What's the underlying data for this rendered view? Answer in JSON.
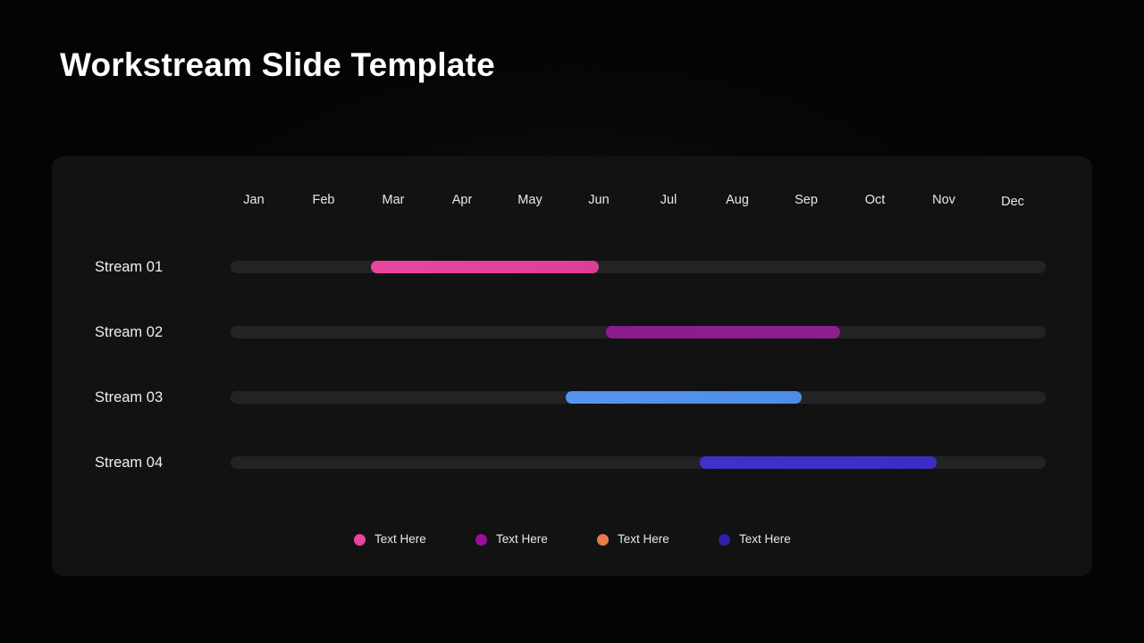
{
  "slide": {
    "title": "Workstream Slide Template",
    "background_color": "#040404",
    "card_color": "#121213"
  },
  "chart_data": {
    "type": "bar",
    "title": "Workstream Slide Template",
    "orientation": "horizontal",
    "xlabel": "",
    "ylabel": "",
    "grid": false,
    "legend_position": "bottom",
    "track_color": "#232325",
    "axis": {
      "categories": [
        "Jan",
        "Feb",
        "Mar",
        "Apr",
        "May",
        "Jun",
        "Jul",
        "Aug",
        "Sep",
        "Oct",
        "Nov",
        "Dec"
      ],
      "tick_x": [
        284,
        362,
        440,
        517,
        593,
        670,
        748,
        825,
        902,
        979,
        1056,
        1133
      ],
      "tick_y": [
        224,
        224,
        224,
        224,
        224,
        224,
        224,
        224,
        224,
        224,
        224,
        226
      ]
    },
    "categories": [
      "Stream 01",
      "Stream 02",
      "Stream 03",
      "Stream 04"
    ],
    "series": [
      {
        "name": "Stream 01",
        "start_month": "Mar",
        "end_month": "Jun",
        "start_x": 415,
        "end_x": 670,
        "row_y": 299,
        "color": "#e8479f",
        "color_end": "#e03e96"
      },
      {
        "name": "Stream 02",
        "start_month": "Jun",
        "end_month": "Sep",
        "start_x": 678,
        "end_x": 940,
        "row_y": 372,
        "color": "#8d1b8d",
        "color_end": "#8e1f90"
      },
      {
        "name": "Stream 03",
        "start_month": "May",
        "end_month": "Aug",
        "start_x": 633,
        "end_x": 897,
        "row_y": 445,
        "color": "#5496ee",
        "color_end": "#4b8ee8"
      },
      {
        "name": "Stream 04",
        "start_month": "Aug",
        "end_month": "Nov",
        "start_x": 783,
        "end_x": 1048,
        "row_y": 518,
        "color": "#3f32cb",
        "color_end": "#3a2ec2"
      }
    ],
    "legend": [
      {
        "label": "Text Here",
        "color": "#e8449c",
        "x": 396
      },
      {
        "label": "Text Here",
        "color": "#9b0f9b",
        "x": 532
      },
      {
        "label": "Text Here",
        "color": "#e87b4a",
        "x": 668
      },
      {
        "label": "Text Here",
        "color": "#2d1fa8",
        "x": 804
      }
    ]
  }
}
